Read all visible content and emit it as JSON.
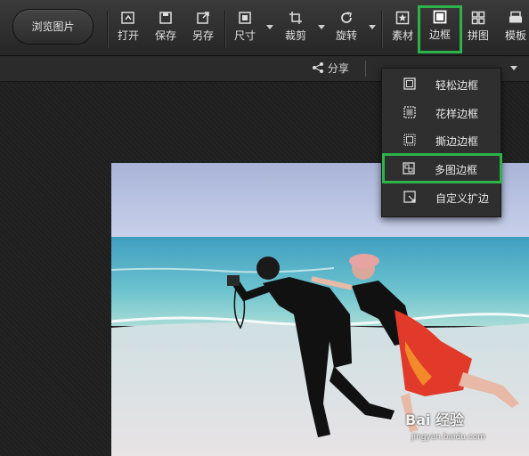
{
  "toolbar": {
    "browse_label": "浏览图片",
    "tools": [
      {
        "label": "打开",
        "icon": "open-icon"
      },
      {
        "label": "保存",
        "icon": "save-icon"
      },
      {
        "label": "另存",
        "icon": "save-as-icon"
      },
      {
        "label": "尺寸",
        "icon": "resize-icon"
      },
      {
        "label": "裁剪",
        "icon": "crop-icon"
      },
      {
        "label": "旋转",
        "icon": "rotate-icon"
      },
      {
        "label": "素材",
        "icon": "material-icon"
      },
      {
        "label": "边框",
        "icon": "border-icon"
      },
      {
        "label": "拼图",
        "icon": "collage-icon"
      },
      {
        "label": "模板",
        "icon": "template-icon"
      }
    ],
    "active_tool": "边框"
  },
  "subbar": {
    "share_label": "分享"
  },
  "border_menu": {
    "items": [
      {
        "label": "轻松边框",
        "icon": "simple-border-icon"
      },
      {
        "label": "花样边框",
        "icon": "fancy-border-icon"
      },
      {
        "label": "撕边边框",
        "icon": "torn-border-icon"
      },
      {
        "label": "多图边框",
        "icon": "multi-image-border-icon"
      },
      {
        "label": "自定义扩边",
        "icon": "custom-extend-icon"
      }
    ],
    "highlighted": "多图边框"
  },
  "watermark": {
    "brand": "Bai 经验",
    "url": "jingyan.baidu.com"
  },
  "colors": {
    "highlight": "#2db34a",
    "toolbar_bg": "#2e2e2e"
  }
}
